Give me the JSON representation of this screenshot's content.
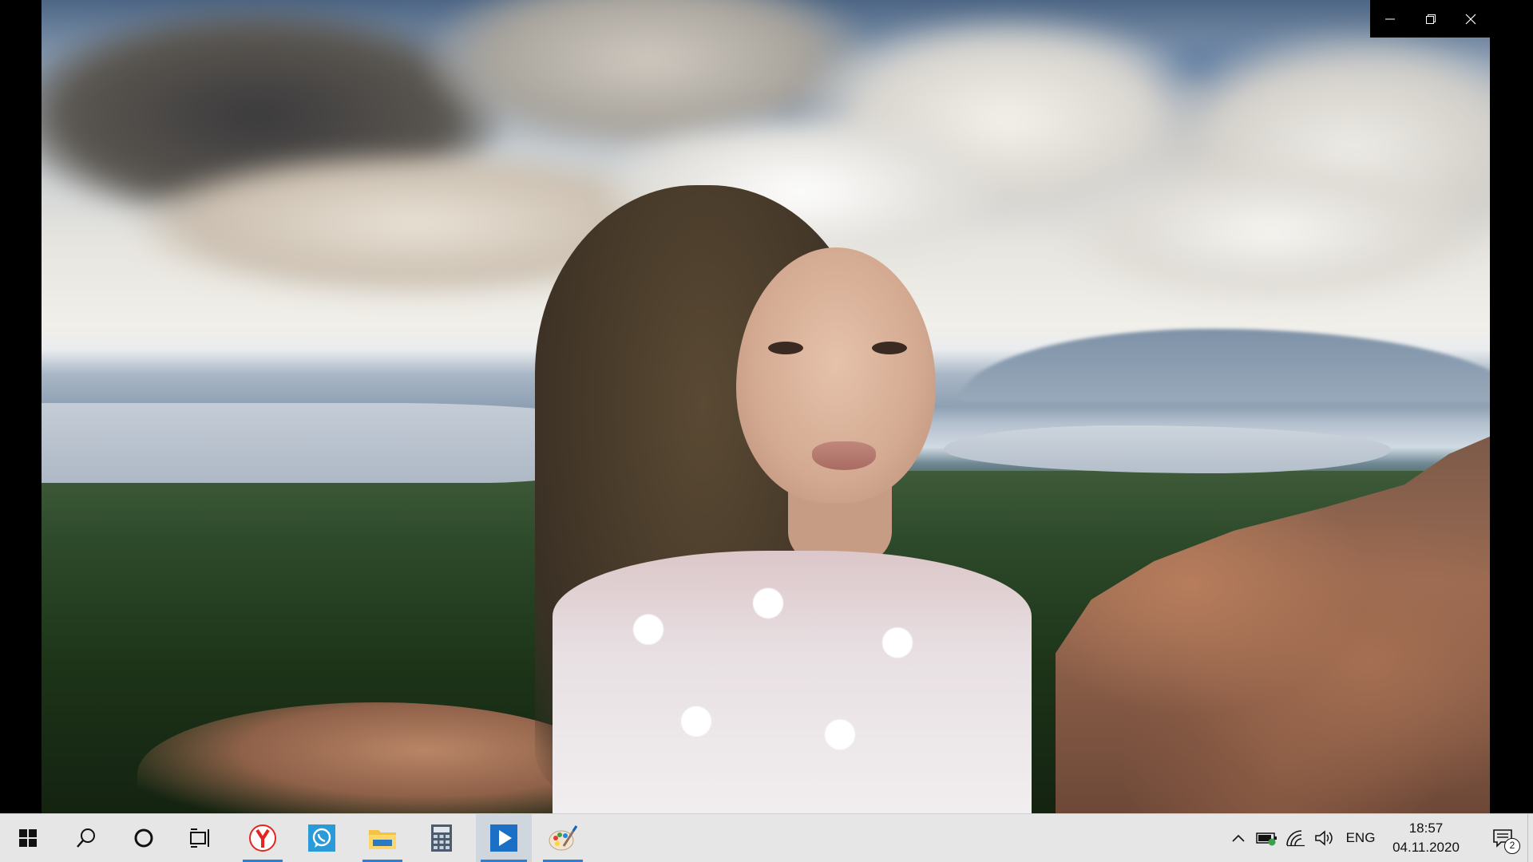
{
  "window": {
    "caption": {
      "minimize": "minimize",
      "restore": "restore",
      "close": "close"
    }
  },
  "taskbar": {
    "icons": [
      "windows-start-icon",
      "search-icon",
      "cortana-icon",
      "task-view-icon",
      "yandex-browser-icon",
      "whatsapp-icon",
      "file-explorer-icon",
      "calculator-icon",
      "movies-tv-icon",
      "paint-icon"
    ],
    "accent_color": "#2b7fd6",
    "tray": {
      "language": "ENG",
      "time": "18:57",
      "date": "04.11.2020",
      "notification_count": "2"
    }
  }
}
